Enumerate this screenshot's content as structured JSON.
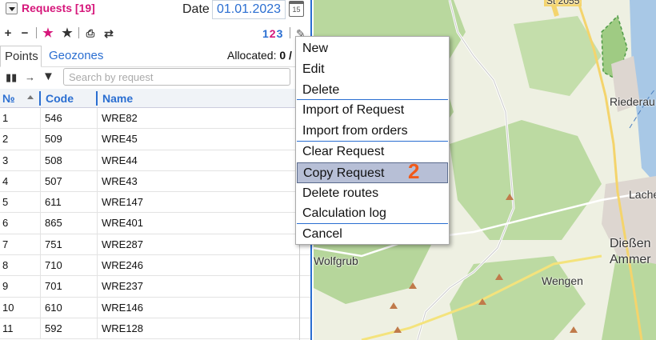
{
  "header": {
    "title": "Requests [19]",
    "date_label": "Date",
    "date_value": "01.01.2023",
    "calendar_day": "15"
  },
  "toolbar": {
    "pages": [
      "1",
      "2",
      "3"
    ],
    "current_page": "2"
  },
  "tabs": {
    "points": "Points",
    "geozones": "Geozones",
    "allocated_label": "Allocated:",
    "allocated_value": "0 /"
  },
  "search": {
    "placeholder": "Search by request"
  },
  "table": {
    "columns": [
      "№",
      "Code",
      "Name"
    ],
    "rows": [
      {
        "no": "1",
        "code": "546",
        "name": "WRE82"
      },
      {
        "no": "2",
        "code": "509",
        "name": "WRE45"
      },
      {
        "no": "3",
        "code": "508",
        "name": "WRE44"
      },
      {
        "no": "4",
        "code": "507",
        "name": "WRE43"
      },
      {
        "no": "5",
        "code": "611",
        "name": "WRE147"
      },
      {
        "no": "6",
        "code": "865",
        "name": "WRE401"
      },
      {
        "no": "7",
        "code": "751",
        "name": "WRE287"
      },
      {
        "no": "8",
        "code": "710",
        "name": "WRE246"
      },
      {
        "no": "9",
        "code": "701",
        "name": "WRE237"
      },
      {
        "no": "10",
        "code": "610",
        "name": "WRE146"
      },
      {
        "no": "11",
        "code": "592",
        "name": "WRE128"
      }
    ]
  },
  "context_menu": {
    "items": [
      {
        "label": "New"
      },
      {
        "label": "Edit"
      },
      {
        "label": "Delete"
      },
      {
        "label": "Import of Request"
      },
      {
        "label": "Import from orders"
      },
      {
        "label": "Clear Request"
      },
      {
        "label": "Copy Request"
      },
      {
        "label": "Delete routes"
      },
      {
        "label": "Calculation log"
      },
      {
        "label": "Cancel"
      }
    ],
    "highlighted": "Copy Request",
    "step_badge": "2"
  },
  "map": {
    "places": [
      "St 2055",
      "Riederau",
      "Lacher",
      "Dießen",
      "Ammer",
      "Wolfgrub",
      "Wengen"
    ]
  },
  "colors": {
    "accent": "#2a6ed1",
    "title": "#d6177b",
    "badge": "#f05a1a",
    "map_forest": "#b9d89e",
    "map_field": "#eef0e2",
    "map_water": "#a8c8e6"
  }
}
